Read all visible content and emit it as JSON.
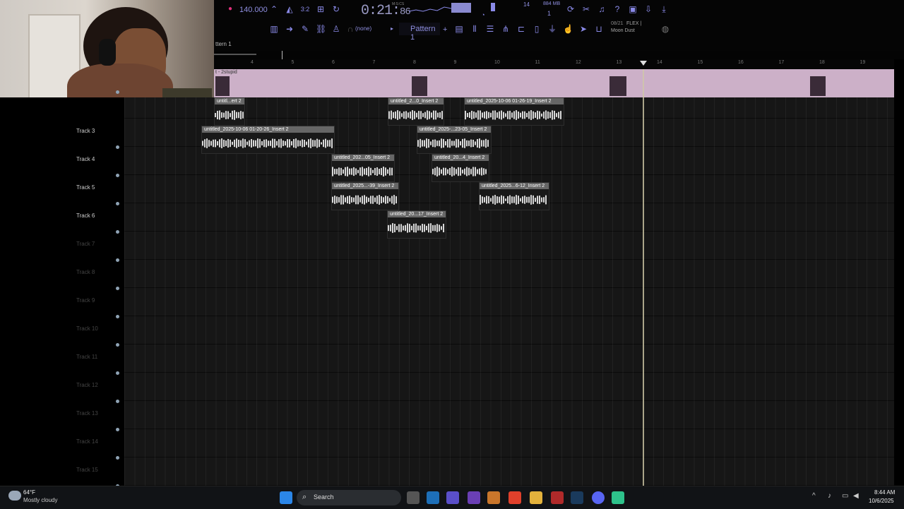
{
  "toolbar": {
    "tempo": "140.000",
    "time_main": "0:21",
    "time_sub": "86",
    "time_unit": "M:S:CS",
    "cpu": "14",
    "mem": "884 MB",
    "voices": "1",
    "none_label": "(none)",
    "pattern_label": "Pattern 1",
    "news_date": "08/21",
    "news_flex": "FLEX |",
    "news_title": "Moon Dust"
  },
  "pattern_bar": {
    "label": "ttern 1"
  },
  "master": {
    "label": "t - 2stupid"
  },
  "ruler": {
    "ticks": [
      "4",
      "5",
      "6",
      "7",
      "8",
      "9",
      "10",
      "11",
      "12",
      "13",
      "14",
      "15",
      "16",
      "17",
      "18",
      "19"
    ]
  },
  "tracks": [
    {
      "label": "Track 3"
    },
    {
      "label": "Track 4"
    },
    {
      "label": "Track 5"
    },
    {
      "label": "Track 6"
    },
    {
      "label": "Track 7"
    },
    {
      "label": "Track 8"
    },
    {
      "label": "Track 9"
    },
    {
      "label": "Track 10"
    },
    {
      "label": "Track 11"
    },
    {
      "label": "Track 12"
    },
    {
      "label": "Track 13"
    },
    {
      "label": "Track 14"
    },
    {
      "label": "Track 15"
    }
  ],
  "clips": [
    {
      "name": "untitl...ert 2"
    },
    {
      "name": "untitled_2...0_Insert 2"
    },
    {
      "name": "untitled_2025-10-06 01-26-19_Insert 2"
    },
    {
      "name": "untitled_2025-10-06 01-20-26_Insert 2"
    },
    {
      "name": "untitled_2025-...23-05_Insert 2"
    },
    {
      "name": "untitled_202...05_Insert 2"
    },
    {
      "name": "untitled_20...4_Insert 2"
    },
    {
      "name": "untitled_2025...-39_Insert 2"
    },
    {
      "name": "untitled_2025...6-12_Insert 2"
    },
    {
      "name": "untitled_20...17_Insert 2"
    }
  ],
  "taskbar": {
    "weather_temp": "64°F",
    "weather_desc": "Mostly cloudy",
    "search_placeholder": "Search",
    "time": "8:44 AM",
    "date": "10/6/2025"
  },
  "icons": [
    "record-icon",
    "tempo-icon",
    "metronome-icon",
    "waveform-icon",
    "piano-roll-icon",
    "mixer-icon",
    "channel-rack-icon",
    "browser-icon",
    "plugin-icon",
    "help-icon",
    "save-icon",
    "export-icon",
    "globe-icon",
    "windows-start-icon",
    "search-icon",
    "file-explorer-icon",
    "brave-icon",
    "steam-icon",
    "discord-icon",
    "speaker-icon",
    "wifi-icon",
    "mic-icon"
  ],
  "colors": {
    "accent": "#8a8ae8",
    "master_lane": "#ccb0c8",
    "clip_header": "#666666",
    "playhead": "#cfc8a6"
  }
}
